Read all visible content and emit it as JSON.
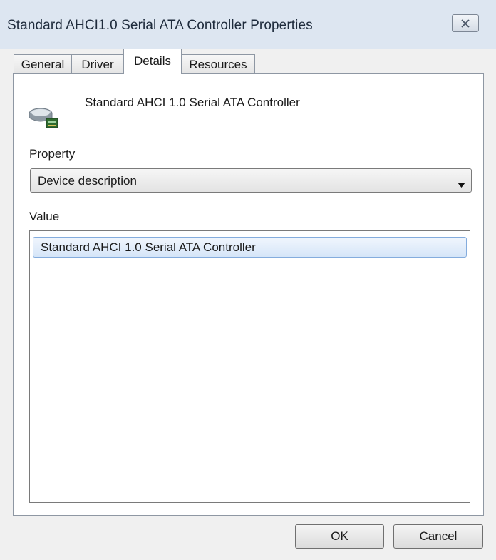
{
  "window": {
    "title": "Standard AHCI1.0 Serial ATA Controller Properties",
    "close_icon": "close-x-icon"
  },
  "tabs": [
    {
      "label": "General",
      "active": false
    },
    {
      "label": "Driver",
      "active": false
    },
    {
      "label": "Details",
      "active": true
    },
    {
      "label": "Resources",
      "active": false
    }
  ],
  "device": {
    "icon": "storage-controller-icon",
    "name": "Standard AHCI 1.0 Serial ATA Controller"
  },
  "property": {
    "label": "Property",
    "selected": "Device description"
  },
  "value": {
    "label": "Value",
    "items": [
      "Standard AHCI 1.0 Serial ATA Controller"
    ]
  },
  "buttons": {
    "ok": "OK",
    "cancel": "Cancel"
  },
  "colors": {
    "titlebar": "#dde6f1",
    "selection": "#d5e5f8",
    "selection_border": "#84acdd"
  }
}
